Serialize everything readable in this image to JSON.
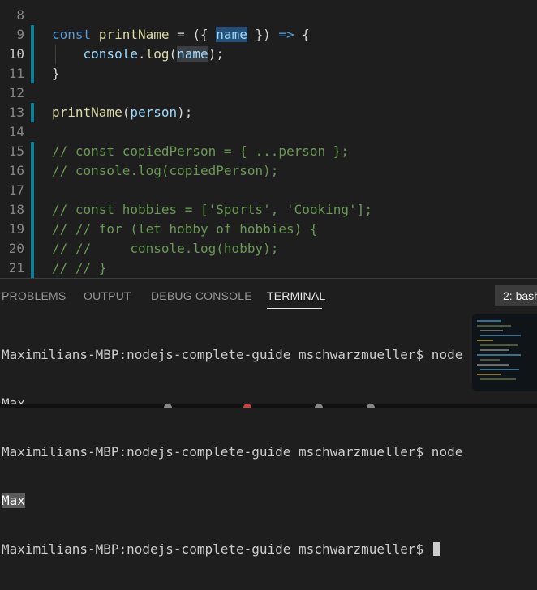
{
  "editor": {
    "lines": [
      {
        "num": "8",
        "tokens": []
      },
      {
        "num": "9",
        "tokens": [
          {
            "t": "const ",
            "c": "kw"
          },
          {
            "t": "printName",
            "c": "fn"
          },
          {
            "t": " = ({ ",
            "c": "punc"
          },
          {
            "t": "name",
            "c": "var hl-sel"
          },
          {
            "t": " }) ",
            "c": "punc"
          },
          {
            "t": "=>",
            "c": "kw"
          },
          {
            "t": " {",
            "c": "punc"
          }
        ]
      },
      {
        "num": "10",
        "active": true,
        "tokens": [
          {
            "t": "    ",
            "c": "punc"
          },
          {
            "t": "console",
            "c": "var"
          },
          {
            "t": ".",
            "c": "punc"
          },
          {
            "t": "log",
            "c": "fn"
          },
          {
            "t": "(",
            "c": "punc"
          },
          {
            "t": "name",
            "c": "var hl-word"
          },
          {
            "t": ");",
            "c": "punc"
          }
        ]
      },
      {
        "num": "11",
        "tokens": [
          {
            "t": "}",
            "c": "punc"
          }
        ]
      },
      {
        "num": "12",
        "tokens": []
      },
      {
        "num": "13",
        "tokens": [
          {
            "t": "printName",
            "c": "fn"
          },
          {
            "t": "(",
            "c": "punc"
          },
          {
            "t": "person",
            "c": "var"
          },
          {
            "t": ");",
            "c": "punc"
          }
        ]
      },
      {
        "num": "14",
        "tokens": []
      },
      {
        "num": "15",
        "tokens": [
          {
            "t": "// const copiedPerson = { ...person };",
            "c": "cm"
          }
        ]
      },
      {
        "num": "16",
        "tokens": [
          {
            "t": "// console.log(copiedPerson);",
            "c": "cm"
          }
        ]
      },
      {
        "num": "17",
        "tokens": []
      },
      {
        "num": "18",
        "tokens": [
          {
            "t": "// const hobbies = ['Sports', 'Cooking'];",
            "c": "cm"
          }
        ]
      },
      {
        "num": "19",
        "tokens": [
          {
            "t": "// // for (let hobby of hobbies) {",
            "c": "cm"
          }
        ]
      },
      {
        "num": "20",
        "tokens": [
          {
            "t": "// //     console.log(hobby);",
            "c": "cm"
          }
        ]
      },
      {
        "num": "21",
        "tokens": [
          {
            "t": "// // }",
            "c": "cm"
          }
        ]
      }
    ]
  },
  "panel": {
    "tabs": [
      "PROBLEMS",
      "OUTPUT",
      "DEBUG CONSOLE",
      "TERMINAL"
    ],
    "active_tab": "TERMINAL",
    "shell_select": "2: bash"
  },
  "terminal": {
    "lines": [
      "Maximilians-MBP:nodejs-complete-guide mschwarzmueller$ node",
      "Max",
      "Maximilians-MBP:nodejs-complete-guide mschwarzmueller$ node",
      "Max",
      "Maximilians-MBP:nodejs-complete-guide mschwarzmueller$ "
    ]
  },
  "colors": {
    "background": "#1e1e1e",
    "keyword": "#569cd6",
    "function": "#dcdcaa",
    "variable": "#9cdcfe",
    "comment": "#6a9955",
    "gutter_accent": "#0c7d9d"
  }
}
